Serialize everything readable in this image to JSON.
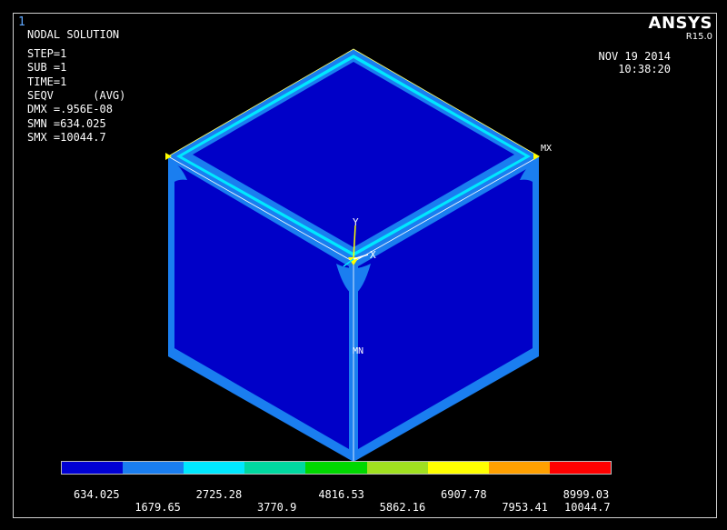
{
  "window_number": "1",
  "brand": {
    "logo": "ANSYS",
    "release": "R15.0"
  },
  "info": {
    "title": "NODAL SOLUTION",
    "lines": [
      "STEP=1",
      "SUB =1",
      "TIME=1",
      "SEQV      (AVG)",
      "DMX =.956E-08",
      "SMN =634.025",
      "SMX =10044.7"
    ]
  },
  "datetime": {
    "date": "NOV 19 2014",
    "time": "10:38:20"
  },
  "markers": {
    "max": "MX",
    "min": "MN",
    "axis_x": "X",
    "axis_y": "Y"
  },
  "legend": {
    "colors": [
      "#0000d4",
      "#1a7ef0",
      "#00e8ff",
      "#00d8a0",
      "#00d800",
      "#a0e020",
      "#ffff00",
      "#ffa000",
      "#ff0000"
    ],
    "ticks": [
      "634.025",
      "1679.65",
      "2725.28",
      "3770.9",
      "4816.53",
      "5862.16",
      "6907.78",
      "7953.41",
      "8999.03",
      "10044.7"
    ]
  },
  "model_colors": {
    "face": "#0000c8",
    "edge": "#1a7ef0",
    "highlight": "#00e8ff",
    "hot": "#ffff00"
  }
}
